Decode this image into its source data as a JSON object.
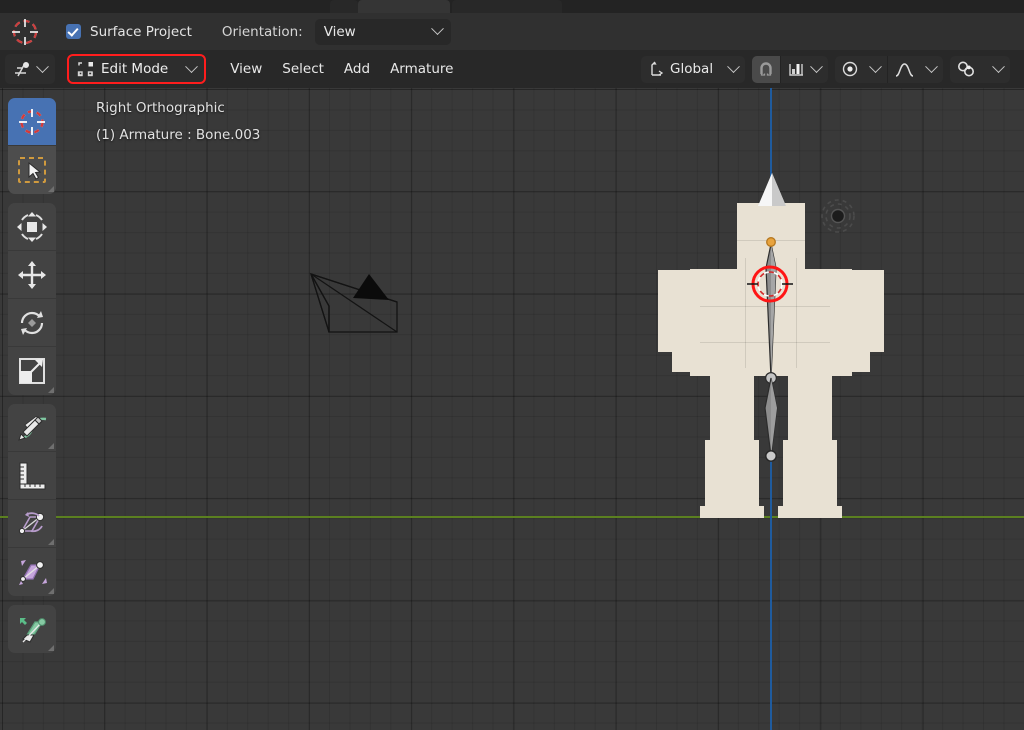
{
  "app": {
    "name": "Blender",
    "theme_bg": "#393939",
    "accent": "#4772b3",
    "highlight_red": "#ff1d1d"
  },
  "tool_settings_bar": {
    "cursor_gizmo_icon": "3d-cursor-icon",
    "surface_project": {
      "label": "Surface Project",
      "checked": true,
      "checkbox_color": "#4772b3"
    },
    "orientation": {
      "label": "Orientation:",
      "value": "View",
      "icon": "chevron-down-icon"
    }
  },
  "header": {
    "editor_type": {
      "icon": "armature-editor-icon",
      "chevron": "chevron-down-icon"
    },
    "mode": {
      "label": "Edit Mode",
      "icon": "edit-mode-icon",
      "chevron": "chevron-down-icon",
      "outline_color": "#ff1d1d"
    },
    "menus": [
      {
        "label": "View"
      },
      {
        "label": "Select"
      },
      {
        "label": "Add"
      },
      {
        "label": "Armature"
      }
    ],
    "transform_orientation": {
      "label": "Global",
      "icon": "orientation-axes-icon",
      "chevron": "chevron-down-icon"
    },
    "snapping": {
      "magnet_icon": "magnet-icon",
      "magnet_enabled": true,
      "target_icon": "snap-increment-icon",
      "chevron": "chevron-down-icon"
    },
    "proportional_editing": {
      "icon": "proportional-edit-icon",
      "chevron": "chevron-down-icon",
      "falloff_icon": "smooth-falloff-curve-icon",
      "falloff_chevron": "chevron-down-icon"
    },
    "mirror": {
      "icon": "x-axis-mirror-icon",
      "chevron": "chevron-down-icon"
    }
  },
  "viewport": {
    "view_name": "Right Orthographic",
    "object_info": "(1) Armature : Bone.003",
    "axis_x_color": "#5b8020",
    "axis_z_color": "#1f5b9e",
    "grid_enabled": true,
    "nav_gizmo_icon": "view-axis-gizmo-icon",
    "cursor_icon": "3d-cursor-icon",
    "camera_icon": "camera-wireframe-icon",
    "model_color": "#e8e1d3",
    "bone_color": "#8e8e8e"
  },
  "toolbar": {
    "groups": [
      {
        "items": [
          {
            "name": "tool-cursor",
            "icon": "3d-cursor-tool-icon",
            "active": true
          },
          {
            "name": "tool-select-box",
            "icon": "select-box-icon",
            "active": false,
            "has_corner": true
          }
        ]
      },
      {
        "items": [
          {
            "name": "tool-transform",
            "icon": "transform-icon",
            "active": false
          },
          {
            "name": "tool-move",
            "icon": "move-arrows-icon",
            "active": false
          },
          {
            "name": "tool-rotate",
            "icon": "rotate-icon",
            "active": false
          },
          {
            "name": "tool-scale",
            "icon": "scale-icon",
            "active": false,
            "has_corner": true
          }
        ]
      },
      {
        "items": [
          {
            "name": "tool-annotate",
            "icon": "annotate-pencil-icon",
            "active": false,
            "has_corner": true
          },
          {
            "name": "tool-measure",
            "icon": "measure-ruler-icon",
            "active": false
          },
          {
            "name": "tool-roll",
            "icon": "bone-roll-icon",
            "active": false,
            "has_corner": true
          },
          {
            "name": "tool-bone-size",
            "icon": "bone-size-icon",
            "active": false,
            "has_corner": true
          }
        ]
      },
      {
        "items": [
          {
            "name": "tool-extrude",
            "icon": "bone-extrude-icon",
            "active": false,
            "has_corner": true
          }
        ]
      }
    ]
  }
}
